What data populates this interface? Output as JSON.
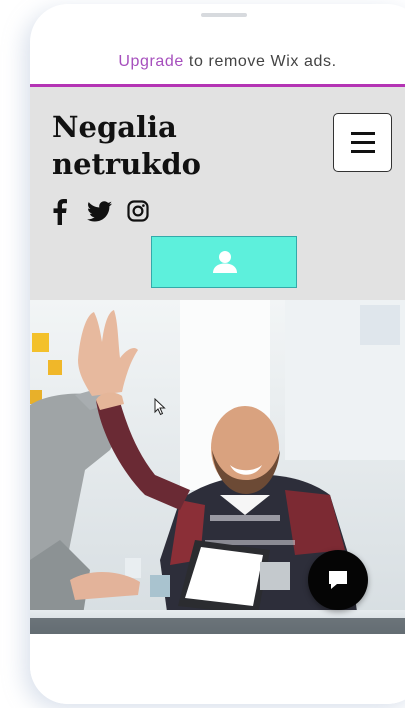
{
  "wix_banner": {
    "upgrade_label": "Upgrade",
    "rest_text": " to remove Wix ads.",
    "accent_color": "#a64fbd",
    "line_color": "#b434b4"
  },
  "header": {
    "site_title_line1": "Negalia",
    "site_title_line2": "netrukdo",
    "background_color": "#e2e2e2"
  },
  "social_icons": [
    "facebook-icon",
    "twitter-icon",
    "instagram-icon"
  ],
  "login_button": {
    "icon": "user-icon",
    "color": "#5df0dc"
  },
  "menu_button": {
    "icon": "hamburger-menu-icon"
  },
  "hero": {
    "image": "two people giving a high five in an office"
  },
  "chat_button": {
    "icon": "chat-icon",
    "color": "#050505"
  }
}
